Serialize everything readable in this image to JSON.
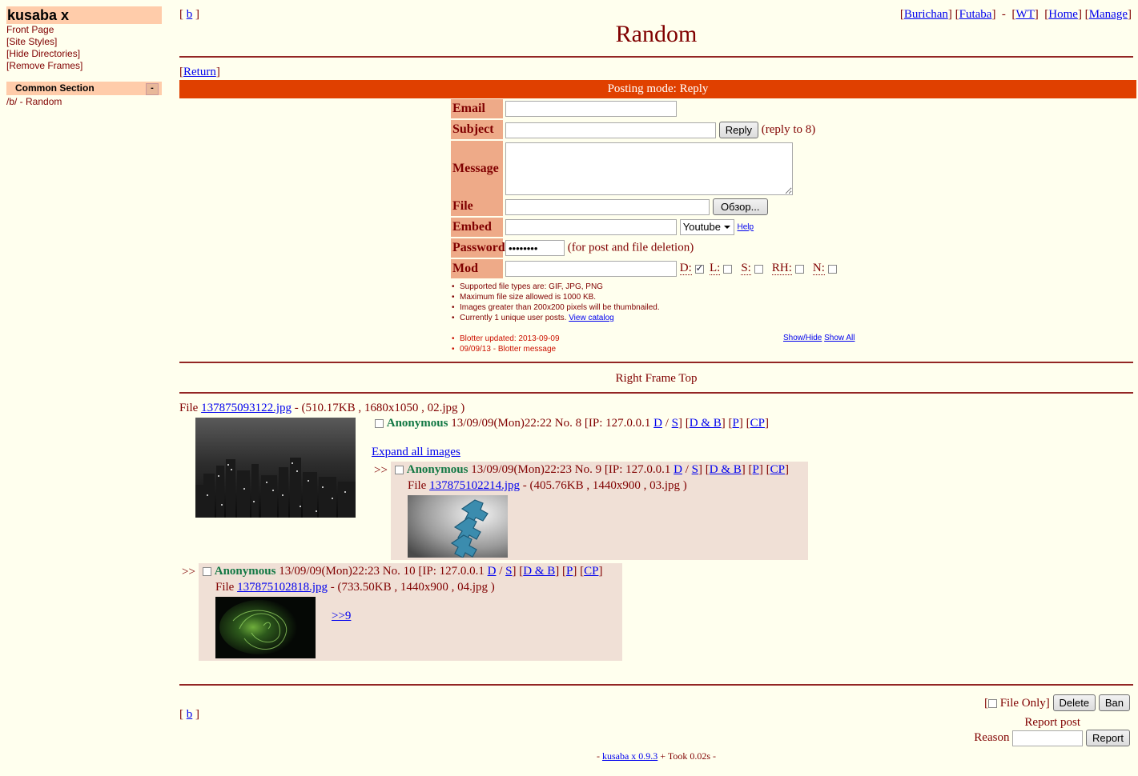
{
  "menu": {
    "site_title": "kusaba x",
    "links": [
      "Front Page",
      "[Site Styles]",
      "[Hide Directories]",
      "[Remove Frames]"
    ],
    "section_title": "Common Section",
    "section_toggle": "-",
    "board_link": "/b/ - Random"
  },
  "nav": {
    "board_open": "[",
    "board": "b",
    "board_close": "]",
    "right_links": [
      "Burichan",
      "Futaba",
      "WT",
      "Home",
      "Manage"
    ]
  },
  "board_title": "Random",
  "return_label": "Return",
  "posting_mode": "Posting mode: Reply",
  "form": {
    "labels": {
      "email": "Email",
      "subject": "Subject",
      "message": "Message",
      "file": "File",
      "embed": "Embed",
      "password": "Password",
      "mod": "Mod"
    },
    "reply_button": "Reply",
    "reply_note": "(reply to 8)",
    "browse_button": "Обзор...",
    "embed_select": "Youtube",
    "help_link": "Help",
    "password_value": "••••••••",
    "password_note": "(for post and file deletion)",
    "mod_flags": [
      "D:",
      "L:",
      "S:",
      "RH:",
      "N:"
    ],
    "mod_checked": [
      true,
      false,
      false,
      false,
      false
    ]
  },
  "rules": [
    "Supported file types are: GIF, JPG, PNG",
    "Maximum file size allowed is 1000 KB.",
    "Images greater than 200x200 pixels will be thumbnailed.",
    "Currently 1 unique user posts."
  ],
  "view_catalog": "View catalog",
  "blotter": {
    "updated": "Blotter updated: 2013-09-09",
    "message": "09/09/13 - Blotter message",
    "show_hide": "Show/Hide",
    "show_all": "Show All"
  },
  "frame_top_text": "Right Frame Top",
  "thread": {
    "op": {
      "file_prefix": "File",
      "file_name": "137875093122.jpg",
      "file_info": "- (510.17KB , 1680x1050 , 02.jpg )",
      "name": "Anonymous",
      "date": "13/09/09(Mon)22:22",
      "no": "No. 8",
      "ip_prefix": "[IP: 127.0.0.1",
      "expand": "Expand all images"
    },
    "replies": [
      {
        "name": "Anonymous",
        "date": "13/09/09(Mon)22:23",
        "no": "No. 9",
        "ip_prefix": "[IP: 127.0.0.1",
        "file_prefix": "File",
        "file_name": "137875102214.jpg",
        "file_info": "- (405.76KB , 1440x900 , 03.jpg )",
        "quote": ""
      },
      {
        "name": "Anonymous",
        "date": "13/09/09(Mon)22:23",
        "no": "No. 10",
        "ip_prefix": "[IP: 127.0.0.1",
        "file_prefix": "File",
        "file_name": "137875102818.jpg",
        "file_info": "- (733.50KB , 1440x900 , 04.jpg )",
        "quote": ">>9"
      }
    ],
    "post_links": {
      "d": "D",
      "sep": "/",
      "s": "S",
      "d_and_b": "D & B",
      "p": "P",
      "cp": "CP"
    },
    "reply_arrow": ">>"
  },
  "footer": {
    "file_only": "File Only]",
    "file_only_open": "[",
    "delete": "Delete",
    "ban": "Ban",
    "report_post": "Report post",
    "reason": "Reason",
    "report": "Report",
    "credit_prefix": "-",
    "credit_link": "kusaba x 0.9.3",
    "credit_suffix": "+ Took 0.02s -"
  }
}
